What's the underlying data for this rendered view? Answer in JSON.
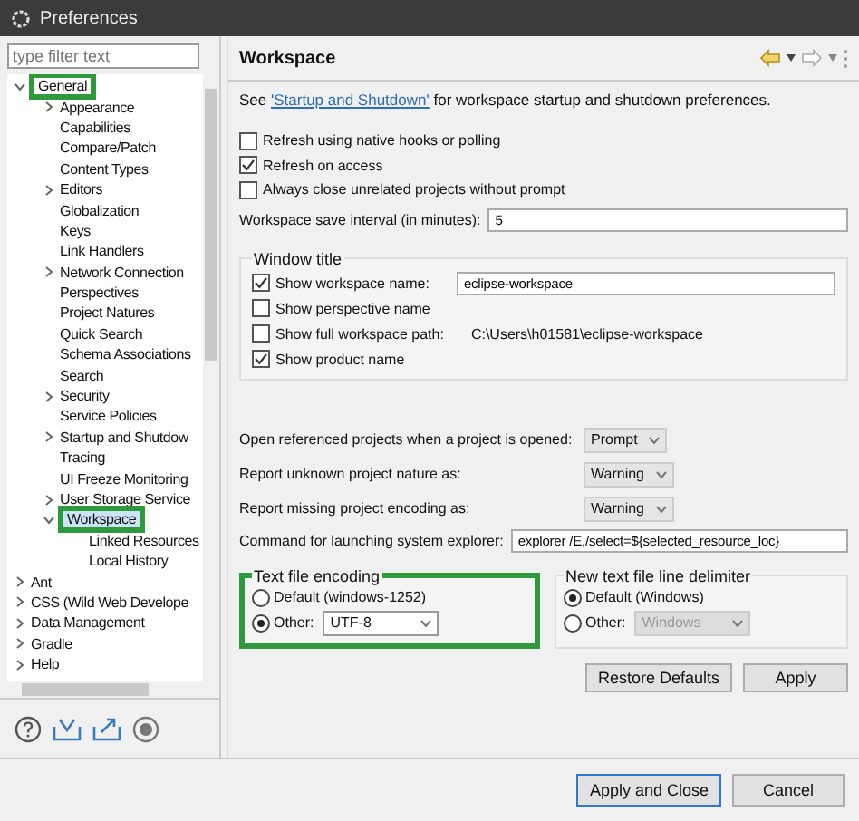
{
  "window": {
    "title": "Preferences"
  },
  "filter": {
    "placeholder": "type filter text"
  },
  "tree": [
    {
      "label": "General",
      "expanded": true,
      "selected": false,
      "highlighted": true,
      "children": [
        {
          "label": "Appearance",
          "expanded": false,
          "selected": false,
          "highlighted": false
        },
        {
          "label": "Capabilities",
          "selected": false,
          "highlighted": false
        },
        {
          "label": "Compare/Patch",
          "selected": false,
          "highlighted": false
        },
        {
          "label": "Content Types",
          "selected": false,
          "highlighted": false
        },
        {
          "label": "Editors",
          "expanded": false,
          "selected": false,
          "highlighted": false
        },
        {
          "label": "Globalization",
          "selected": false,
          "highlighted": false
        },
        {
          "label": "Keys",
          "selected": false,
          "highlighted": false
        },
        {
          "label": "Link Handlers",
          "selected": false,
          "highlighted": false
        },
        {
          "label": "Network Connection",
          "expanded": false,
          "selected": false,
          "highlighted": false
        },
        {
          "label": "Perspectives",
          "selected": false,
          "highlighted": false
        },
        {
          "label": "Project Natures",
          "selected": false,
          "highlighted": false
        },
        {
          "label": "Quick Search",
          "selected": false,
          "highlighted": false
        },
        {
          "label": "Schema Associations",
          "selected": false,
          "highlighted": false
        },
        {
          "label": "Search",
          "selected": false,
          "highlighted": false
        },
        {
          "label": "Security",
          "expanded": false,
          "selected": false,
          "highlighted": false
        },
        {
          "label": "Service Policies",
          "selected": false,
          "highlighted": false
        },
        {
          "label": "Startup and Shutdow",
          "expanded": false,
          "selected": false,
          "highlighted": false
        },
        {
          "label": "Tracing",
          "selected": false,
          "highlighted": false
        },
        {
          "label": "UI Freeze Monitoring",
          "selected": false,
          "highlighted": false
        },
        {
          "label": "User Storage Service",
          "expanded": false,
          "selected": false,
          "highlighted": false
        },
        {
          "label": "Workspace",
          "expanded": true,
          "selected": true,
          "highlighted": true,
          "children": [
            {
              "label": "Linked Resources",
              "selected": false,
              "highlighted": false
            },
            {
              "label": "Local History",
              "selected": false,
              "highlighted": false
            }
          ]
        }
      ]
    },
    {
      "label": "Ant",
      "expanded": false,
      "selected": false,
      "highlighted": false
    },
    {
      "label": "CSS (Wild Web Develope",
      "expanded": false,
      "selected": false,
      "highlighted": false
    },
    {
      "label": "Data Management",
      "expanded": false,
      "selected": false,
      "highlighted": false
    },
    {
      "label": "Gradle",
      "expanded": false,
      "selected": false,
      "highlighted": false
    },
    {
      "label": "Help",
      "expanded": false,
      "selected": false,
      "highlighted": false
    }
  ],
  "page": {
    "title": "Workspace",
    "intro": {
      "before": "See ",
      "link": "'Startup and Shutdown'",
      "after": " for workspace startup and shutdown preferences."
    },
    "options": [
      {
        "label": "Refresh using native hooks or polling",
        "checked": false
      },
      {
        "label": "Refresh on access",
        "checked": true
      },
      {
        "label": "Always close unrelated projects without prompt",
        "checked": false
      }
    ],
    "save_interval": {
      "label": "Workspace save interval (in minutes):",
      "value": "5"
    },
    "window_title": {
      "title": "Window title",
      "options": [
        {
          "kind": "field",
          "label": "Show workspace name:",
          "checked": true,
          "value": "eclipse-workspace"
        },
        {
          "kind": "plain",
          "label": "Show perspective name",
          "checked": false
        },
        {
          "kind": "path",
          "label": "Show full workspace path:",
          "checked": false,
          "value": "C:\\Users\\h01581\\eclipse-workspace"
        },
        {
          "kind": "plain",
          "label": "Show product name",
          "checked": true
        }
      ]
    },
    "selects": [
      {
        "label": "Open referenced projects when a project is opened:",
        "value": "Prompt"
      },
      {
        "label": "Report unknown project nature as:",
        "value": "Warning"
      },
      {
        "label": "Report missing project encoding as:",
        "value": "Warning"
      }
    ],
    "explorer": {
      "label": "Command for launching system explorer:",
      "value": "explorer /E,/select=${selected_resource_loc}"
    },
    "encoding": {
      "title": "Text file encoding",
      "highlighted": true,
      "options": [
        {
          "label": "Default (windows-1252)",
          "selected": false
        },
        {
          "label": "Other:",
          "selected": true,
          "value": "UTF-8",
          "disabled": false
        }
      ]
    },
    "delimiter": {
      "title": "New text file line delimiter",
      "highlighted": false,
      "options": [
        {
          "label": "Default (Windows)",
          "selected": true
        },
        {
          "label": "Other:",
          "selected": false,
          "value": "Windows",
          "disabled": true
        }
      ]
    },
    "buttons": [
      "Restore Defaults",
      "Apply"
    ]
  },
  "footer": {
    "buttons": [
      {
        "label": "Apply and Close",
        "default": true
      },
      {
        "label": "Cancel",
        "default": false
      }
    ]
  }
}
